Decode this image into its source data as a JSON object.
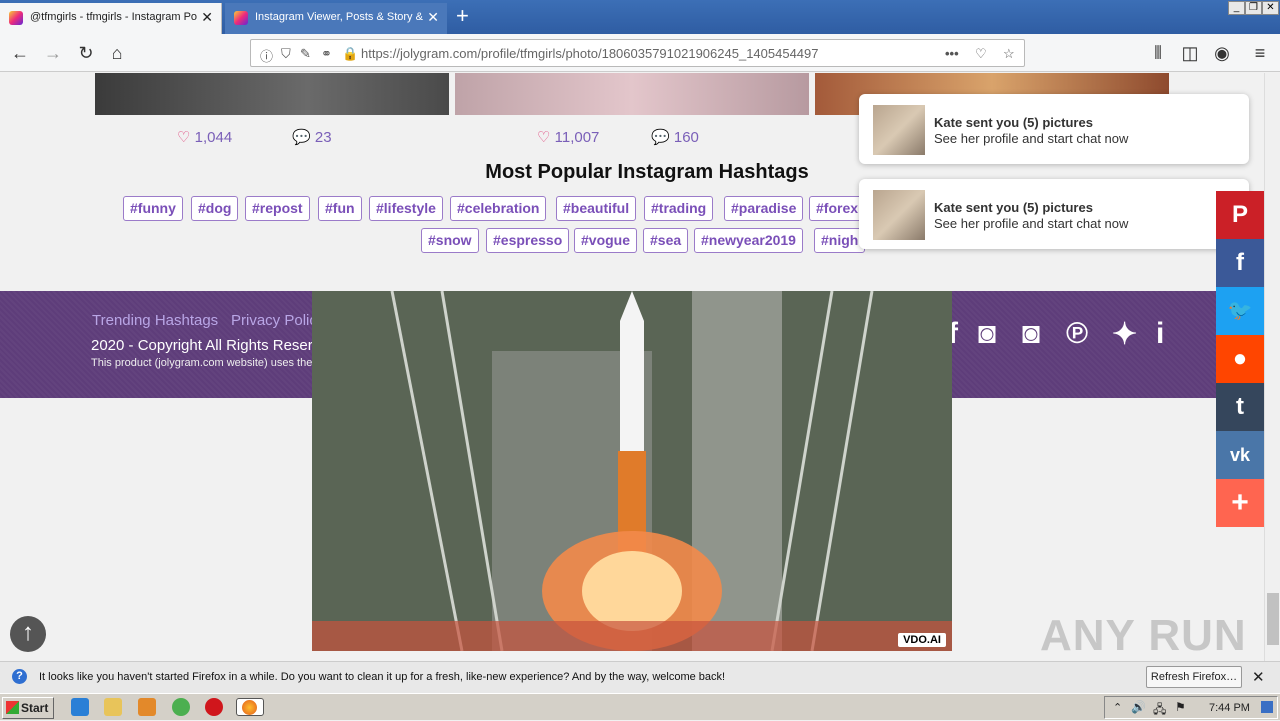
{
  "browser": {
    "tabs": [
      {
        "title": "@tfmgirls - tfmgirls - Instagram Po"
      },
      {
        "title": "Instagram Viewer, Posts & Story &"
      }
    ],
    "url": "https://jolygram.com/profile/tfmgirls/photo/1806035791021906245_1405454497",
    "window_controls": [
      "_",
      "❐",
      "✕"
    ]
  },
  "page": {
    "posts": [
      {
        "likes": "1,044",
        "comments": "23"
      },
      {
        "likes": "11,007",
        "comments": "160"
      }
    ],
    "hashtags_title": "Most Popular Instagram Hashtags",
    "hashtags_row1": [
      "#funny",
      "#dog",
      "#repost",
      "#fun",
      "#lifestyle",
      "#celebration",
      "#beautiful",
      "#trading",
      "#paradise",
      "#forex"
    ],
    "hashtags_row2": [
      "#snow",
      "#espresso",
      "#vogue",
      "#sea",
      "#newyear2019",
      "#nigh"
    ],
    "footer": {
      "links": [
        "Trending Hashtags",
        "Privacy Polic"
      ],
      "copyright": "2020 - Copyright All Rights Reserv",
      "product_note": "This product (jolygram.com website) uses the"
    },
    "video_badge": "VDO.AI",
    "watermark": "ANY RUN"
  },
  "notifications": [
    {
      "title": "Kate sent you (5) pictures",
      "text": "See her profile and start chat now"
    },
    {
      "title": "Kate sent you (5) pictures",
      "text": "See her profile and start chat now"
    }
  ],
  "share_bar": [
    {
      "icon": "pinterest-icon",
      "glyph": "P",
      "color": "#cb2027"
    },
    {
      "icon": "facebook-icon",
      "glyph": "f",
      "color": "#3b5998"
    },
    {
      "icon": "twitter-icon",
      "glyph": "🐦",
      "color": "#1da1f2"
    },
    {
      "icon": "reddit-icon",
      "glyph": "●",
      "color": "#ff4500"
    },
    {
      "icon": "tumblr-icon",
      "glyph": "t",
      "color": "#35465c"
    },
    {
      "icon": "vk-icon",
      "glyph": "vk",
      "color": "#4a76a8"
    },
    {
      "icon": "more-icon",
      "glyph": "+",
      "color": "#ff6550"
    }
  ],
  "infobar": {
    "message": "It looks like you haven't started Firefox in a while. Do you want to clean it up for a fresh, like-new experience? And by the way, welcome back!",
    "button": "Refresh Firefox…"
  },
  "taskbar": {
    "start": "Start",
    "clock": "7:44 PM"
  }
}
